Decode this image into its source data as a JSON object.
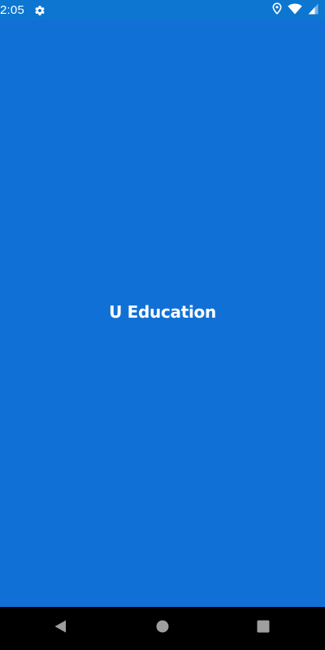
{
  "status_bar": {
    "time": "2:05",
    "icons": [
      "gear-icon",
      "location-icon",
      "wifi-icon",
      "signal-icon"
    ]
  },
  "splash": {
    "title": "U Education",
    "background_color": "#1170d5",
    "text_color": "#ffffff"
  },
  "nav_bar": {
    "buttons": [
      "back-icon",
      "home-icon",
      "recents-icon"
    ],
    "background_color": "#000000",
    "icon_color": "#9e9e9e"
  }
}
